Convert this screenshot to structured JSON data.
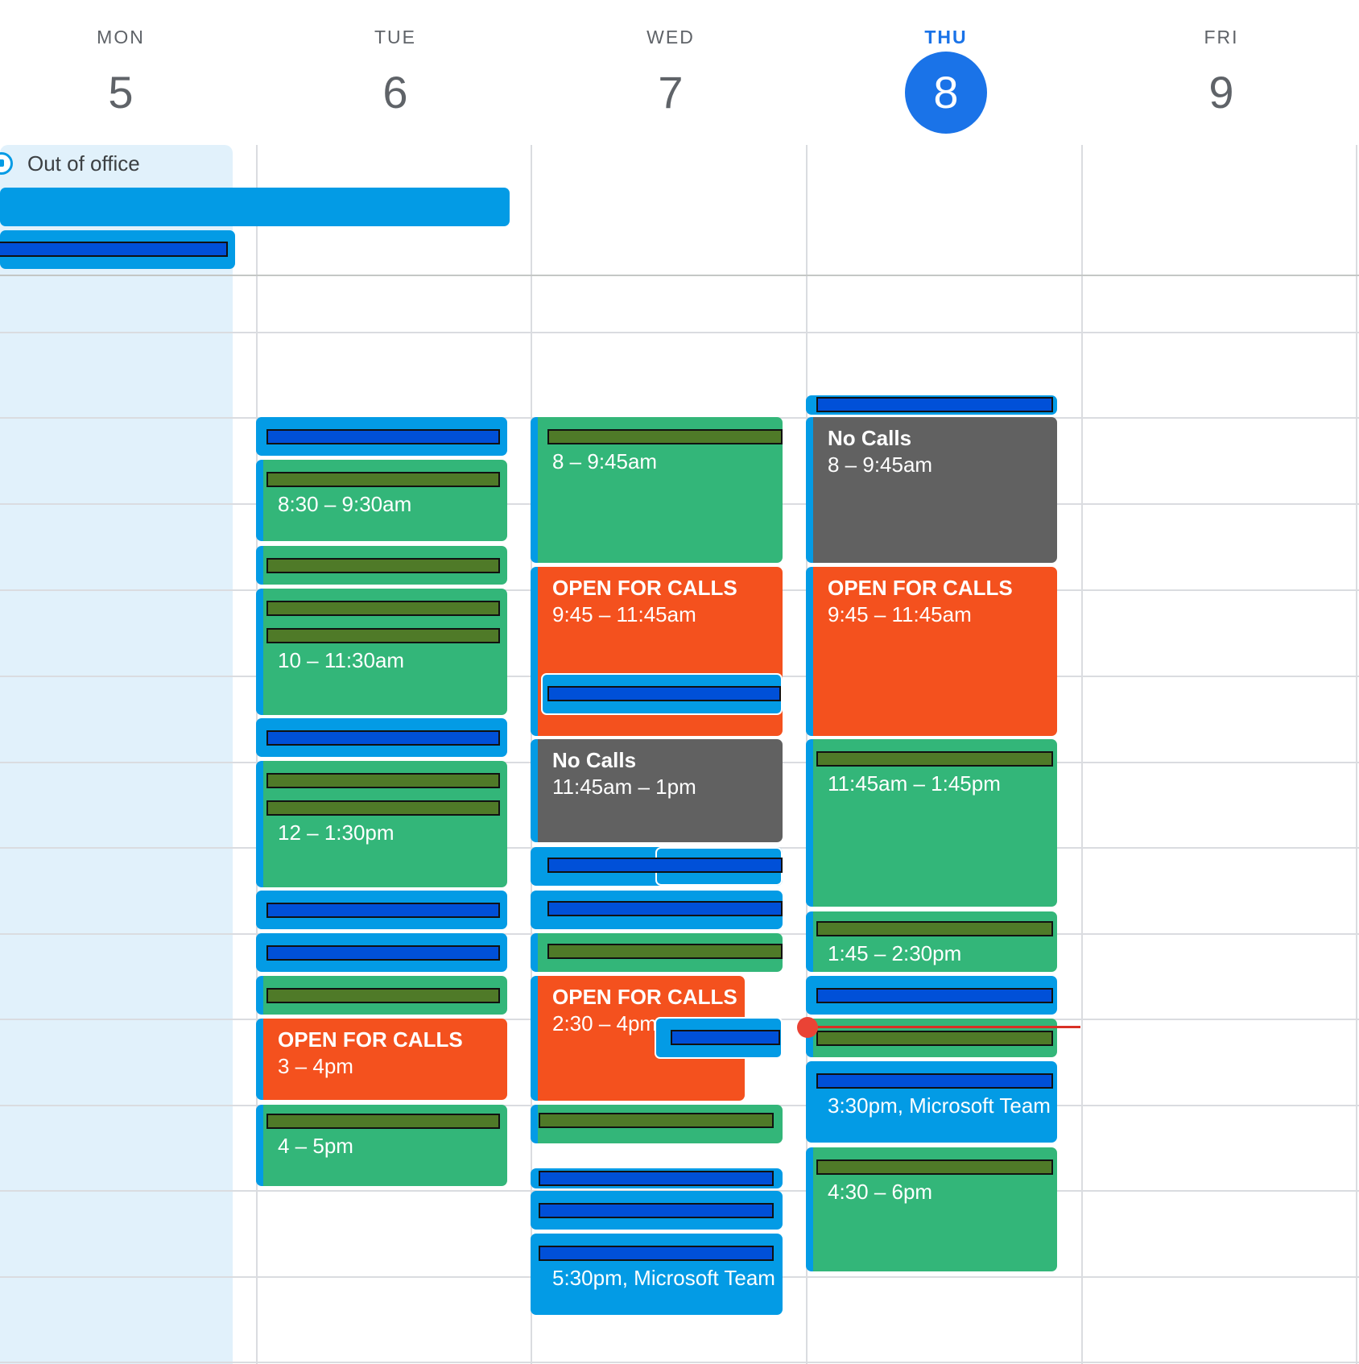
{
  "days": [
    {
      "dow": "MON",
      "num": "5"
    },
    {
      "dow": "TUE",
      "num": "6"
    },
    {
      "dow": "WED",
      "num": "7"
    },
    {
      "dow": "THU",
      "num": "8"
    },
    {
      "dow": "FRI",
      "num": "9"
    }
  ],
  "all_day": {
    "out_of_office": "Out of office"
  },
  "events": {
    "tue": {
      "e2_time": "8:30 – 9:30am",
      "e4_time": "10 – 11:30am",
      "e6_time": "12 – 1:30pm",
      "open_title": "OPEN FOR CALLS",
      "open_time": "3 – 4pm",
      "last_time": "4 – 5pm"
    },
    "wed": {
      "e1_time": "8 – 9:45am",
      "open1_title": "OPEN FOR CALLS",
      "open1_time": "9:45 – 11:45am",
      "nocalls_title": "No Calls",
      "nocalls_time": "11:45am – 1pm",
      "open2_title": "OPEN FOR CALLS",
      "open2_time": "2:30 – 4pm",
      "last_time": "5:30pm, Microsoft Team"
    },
    "thu": {
      "nocalls_title": "No Calls",
      "nocalls_time": "8 – 9:45am",
      "open_title": "OPEN FOR CALLS",
      "open_time": "9:45 – 11:45am",
      "e3_time": "11:45am – 1:45pm",
      "e4_time": "1:45 – 2:30pm",
      "e7_time": "3:30pm, Microsoft Team",
      "e8_time": "4:30 – 6pm"
    }
  }
}
